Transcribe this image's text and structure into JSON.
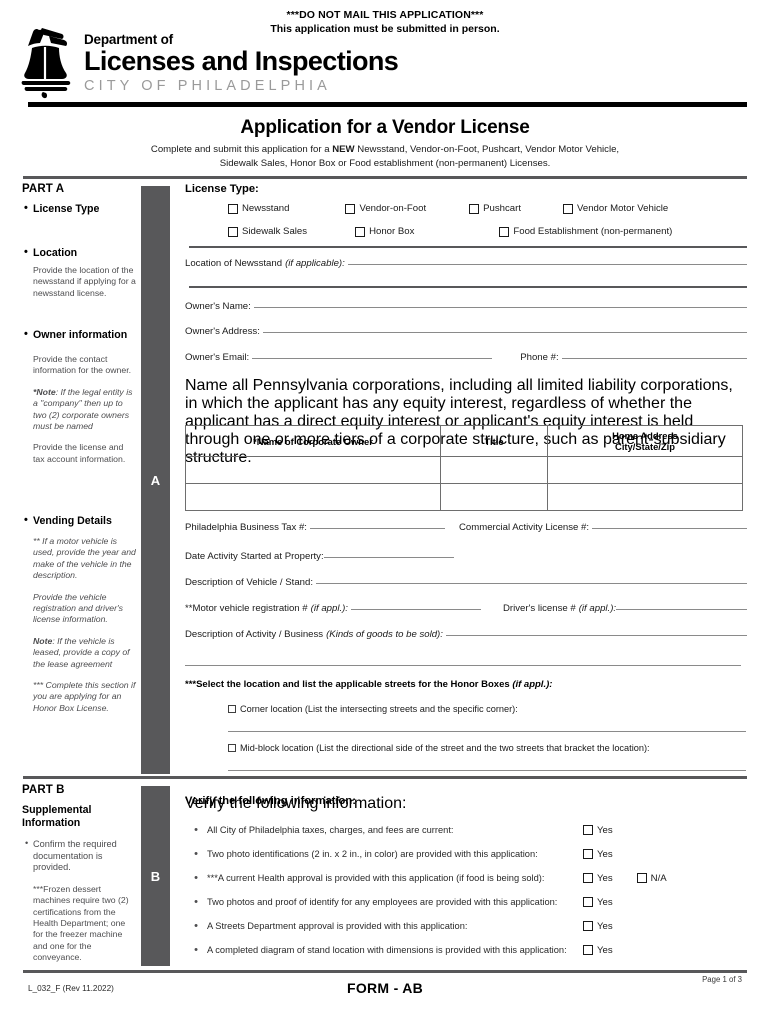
{
  "header": {
    "notice_line1": "***DO NOT MAIL THIS APPLICATION***",
    "notice_line2": "This application must be submitted in person.",
    "brand_dept": "Department of",
    "brand_main": "Licenses and Inspections",
    "brand_city": "CITY OF PHILADELPHIA",
    "title": "Application for a Vendor License",
    "subtitle_pre": "Complete and submit this application for a ",
    "subtitle_bold": "NEW",
    "subtitle_post": " Newsstand, Vendor-on-Foot, Pushcart, Vendor Motor Vehicle,",
    "subtitle_line2": "Sidewalk Sales, Honor Box or Food establishment (non-permanent) Licenses."
  },
  "part_a": {
    "label": "PART A",
    "letter": "A",
    "sidebar": [
      {
        "type": "head",
        "text": "License Type"
      },
      {
        "type": "head",
        "text": "Location"
      },
      {
        "type": "body",
        "text": "Provide the location of the newsstand if applying for a newsstand license."
      },
      {
        "type": "head",
        "text": "Owner information"
      },
      {
        "type": "body",
        "text": "Provide the contact information for the owner."
      },
      {
        "type": "note",
        "bold": "*Note",
        "text": ": If the legal entity is a \"company\" then up to two (2) corporate owners must be named"
      },
      {
        "type": "body",
        "text": "Provide the license and tax account information."
      },
      {
        "type": "head",
        "text": "Vending Details"
      },
      {
        "type": "ital",
        "text": "** If a motor vehicle is used, provide the year and make of the vehicle in the description."
      },
      {
        "type": "ital",
        "text": "Provide the vehicle registration and driver's license information."
      },
      {
        "type": "note",
        "bold": "Note",
        "text": ": If the vehicle is leased, provide a copy of the lease agreement"
      },
      {
        "type": "ital",
        "text": "*** Complete this section if you are applying for an Honor Box License."
      }
    ],
    "section_title": "License Type:",
    "license_types_row1": [
      "Newsstand",
      "Vendor-on-Foot",
      "Pushcart",
      "Vendor Motor Vehicle"
    ],
    "license_types_row2": [
      "Sidewalk Sales",
      "Honor Box",
      "Food Establishment (non-permanent)"
    ],
    "location_label": "Location of Newsstand",
    "location_ital": "(if applicable):",
    "owner_name_label": "Owner's Name:",
    "owner_address_label": "Owner's Address:",
    "owner_email_label": "Owner's Email:",
    "phone_label": "Phone #:",
    "corp_paragraph": "Name all Pennsylvania corporations, including all limited liability corporations, in which the applicant has any equity interest, regardless of whether the applicant has a direct equity interest or applicant's equity interest is held through one or more tiers of a corporate structure, such as parent-subsidiary structure.",
    "corp_table": {
      "headers": [
        "*Name of Corporate Owner",
        "Title",
        "Home Address\nCity/State/Zip"
      ],
      "header_col3_line1": "Home Address",
      "header_col3_line2": "City/State/Zip",
      "rows": [
        [
          "",
          "",
          ""
        ],
        [
          "",
          "",
          ""
        ]
      ]
    },
    "biz_tax_label": "Philadelphia Business Tax #:",
    "commercial_activity_label": "Commercial Activity License #:",
    "date_started_label": "Date Activity Started at Property:",
    "desc_vehicle_label": "Description of Vehicle / Stand:",
    "motor_reg_label": "**Motor vehicle registration #",
    "motor_reg_ital": "(if appl.):",
    "drivers_license_label": "Driver's license #",
    "drivers_license_ital": "(if appl.):",
    "desc_activity_label": "Description of Activity / Business",
    "desc_activity_ital": "(Kinds of goods to be sold):",
    "honor_head_bold": "***Select the location and list the applicable streets for the Honor Boxes",
    "honor_head_ital": "(if appl.):",
    "honor_corner": "Corner location (List the intersecting streets and the specific corner):",
    "honor_midblock": "Mid-block location (List the directional side of the street and the two streets that bracket the location):"
  },
  "part_b": {
    "label": "PART B",
    "letter": "B",
    "sidebar_head_line1": "Supplemental",
    "sidebar_head_line2": "Information",
    "sidebar_bullet": "Confirm the required documentation is provided.",
    "sidebar_note": "***Frozen dessert machines require two (2) certifications from the Health Department; one for the freezer machine and one for the conveyance.",
    "verify_title": "Verify the following information:",
    "yes_label": "Yes",
    "na_label": "N/A",
    "items": [
      {
        "text": "All City of Philadelphia taxes, charges, and fees are current:",
        "has_na": false
      },
      {
        "text": "Two photo identifications (2 in. x 2 in., in color) are provided with this application:",
        "has_na": false
      },
      {
        "text": "***A current Health approval is provided with this application (if food is being sold):",
        "has_na": true
      },
      {
        "text": "Two photos and proof of identify for any employees are provided with this application:",
        "has_na": false
      },
      {
        "text": "A Streets Department approval is provided with this application:",
        "has_na": false
      },
      {
        "text": "A completed diagram of stand location with dimensions is provided with this application:",
        "has_na": false
      }
    ]
  },
  "footer": {
    "left": "L_032_F (Rev 11.2022)",
    "center": "FORM - AB",
    "right": "Page 1 of 3"
  },
  "colors": {
    "bar_gray": "#58585a",
    "body_gray": "#4d4d4f",
    "rule_black": "#000000"
  }
}
